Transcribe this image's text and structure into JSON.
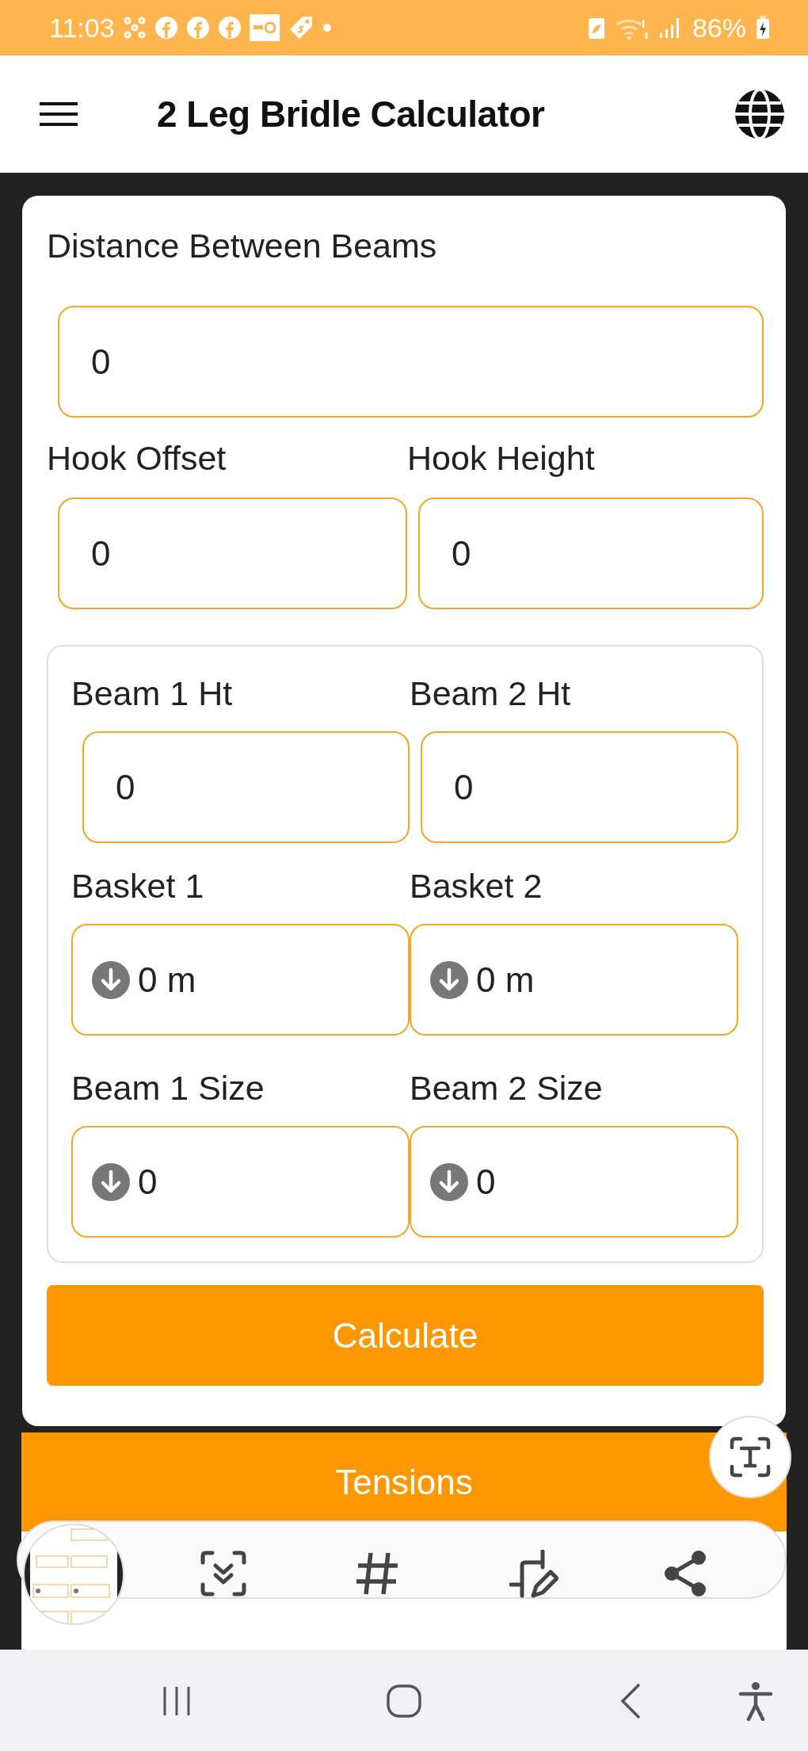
{
  "status_bar": {
    "time": "11:03",
    "battery": "86%"
  },
  "header": {
    "title": "2 Leg Bridle Calculator"
  },
  "form": {
    "top_rows": [
      [
        {
          "label": "Distance Between Beams",
          "value": "0",
          "kind": "text"
        }
      ],
      [
        {
          "label": "Hook Offset",
          "value": "0",
          "kind": "text"
        },
        {
          "label": "Hook Height",
          "value": "0",
          "kind": "text"
        }
      ]
    ],
    "beam_panel": [
      [
        {
          "label": "Beam 1 Ht",
          "value": "0",
          "kind": "text"
        },
        {
          "label": "Beam 2 Ht",
          "value": "0",
          "kind": "text"
        }
      ],
      [
        {
          "label": "Basket 1",
          "value": "0 m",
          "kind": "dropdown"
        },
        {
          "label": "Basket 2",
          "value": "0 m",
          "kind": "dropdown"
        }
      ],
      [
        {
          "label": "Beam 1 Size",
          "value": "0",
          "kind": "dropdown"
        },
        {
          "label": "Beam 2 Size",
          "value": "0",
          "kind": "dropdown"
        }
      ]
    ],
    "calculate_button": "Calculate"
  },
  "tensions": {
    "title": "Tensions"
  }
}
